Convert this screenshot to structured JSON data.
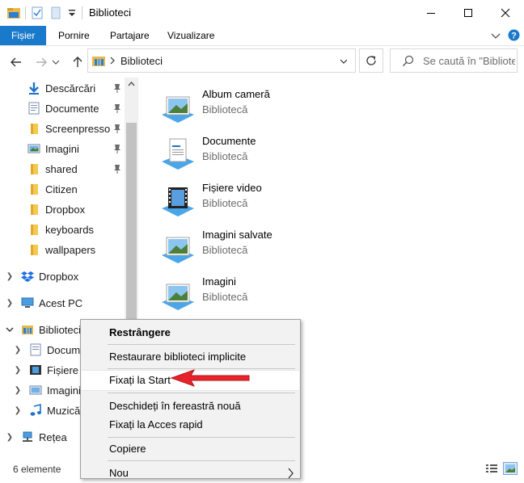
{
  "window": {
    "title": "Biblioteci",
    "controls": [
      "minimize-icon",
      "maximize-icon",
      "close-icon"
    ]
  },
  "ribbon": {
    "tabs": [
      {
        "label": "Fișier",
        "active": true
      },
      {
        "label": "Pornire"
      },
      {
        "label": "Partajare"
      },
      {
        "label": "Vizualizare"
      }
    ]
  },
  "address": {
    "path": "Biblioteci",
    "search_placeholder": "Se caută în \"Biblioteci\""
  },
  "nav": {
    "quick_access": [
      {
        "label": "Descărcări",
        "icon": "download-arrow-icon",
        "pinned": true
      },
      {
        "label": "Documente",
        "icon": "document-icon",
        "pinned": true
      },
      {
        "label": "Screenpresso",
        "icon": "folder-icon",
        "pinned": true
      },
      {
        "label": "Imagini",
        "icon": "pictures-icon",
        "pinned": true
      },
      {
        "label": "shared",
        "icon": "folder-icon",
        "pinned": true
      },
      {
        "label": "Citizen",
        "icon": "folder-icon",
        "pinned": false
      },
      {
        "label": "Dropbox",
        "icon": "folder-icon",
        "pinned": false
      },
      {
        "label": "keyboards",
        "icon": "folder-icon",
        "pinned": false
      },
      {
        "label": "wallpapers",
        "icon": "folder-icon",
        "pinned": false
      }
    ],
    "roots": [
      {
        "label": "Dropbox",
        "icon": "dropbox-icon"
      },
      {
        "label": "Acest PC",
        "icon": "computer-icon"
      },
      {
        "label": "Biblioteci",
        "icon": "libraries-icon",
        "expanded": true,
        "selected": true
      }
    ],
    "library_children": [
      {
        "label": "Documente",
        "icon": "document-icon"
      },
      {
        "label": "Fișiere video",
        "icon": "video-icon"
      },
      {
        "label": "Imagini",
        "icon": "pictures-icon"
      },
      {
        "label": "Muzică",
        "icon": "music-icon"
      }
    ],
    "network": {
      "label": "Rețea",
      "icon": "network-icon"
    }
  },
  "content": {
    "libraries": [
      {
        "name": "Album cameră",
        "type": "Bibliotecă",
        "icon": "camera-roll-library-icon"
      },
      {
        "name": "Documente",
        "type": "Bibliotecă",
        "icon": "documents-library-icon"
      },
      {
        "name": "Fișiere video",
        "type": "Bibliotecă",
        "icon": "videos-library-icon"
      },
      {
        "name": "Imagini salvate",
        "type": "Bibliotecă",
        "icon": "saved-pictures-library-icon"
      },
      {
        "name": "Imagini",
        "type": "Bibliotecă",
        "icon": "pictures-library-icon"
      }
    ]
  },
  "status": {
    "item_count": "6 elemente"
  },
  "context_menu": {
    "items": [
      {
        "label": "Restrângere",
        "bold": true
      },
      {
        "label": "Restaurare biblioteci implicite"
      },
      {
        "label": "Fixați la Start",
        "highlighted": true
      },
      {
        "label": "Deschideți în fereastră nouă"
      },
      {
        "label": "Fixați la Acces rapid"
      },
      {
        "label": "Copiere"
      },
      {
        "label": "Nou",
        "submenu": true
      }
    ]
  },
  "colors": {
    "file_tab": "#1979ca",
    "folder": "#e8b84a",
    "annotation_arrow": "#e8222a"
  }
}
